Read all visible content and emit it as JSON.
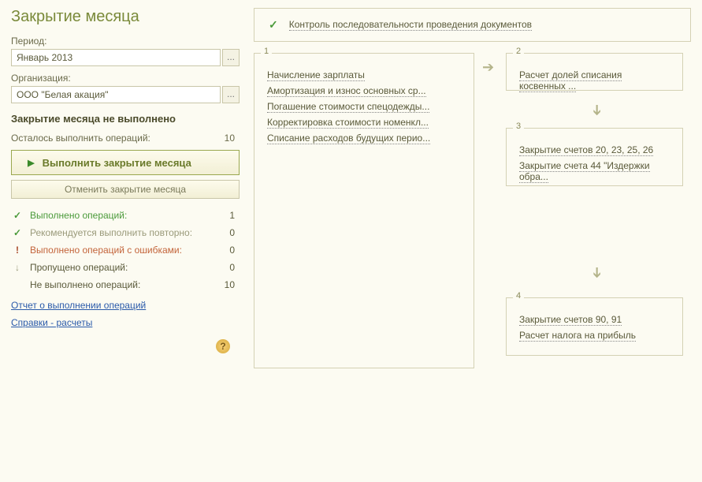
{
  "title": "Закрытие месяца",
  "period_label": "Период:",
  "period_value": "Январь 2013",
  "org_label": "Организация:",
  "org_value": "ООО \"Белая акация\"",
  "status": "Закрытие месяца не выполнено",
  "remaining_label": "Осталось выполнить операций:",
  "remaining_count": "10",
  "execute_button": "Выполнить закрытие месяца",
  "cancel_button": "Отменить закрытие месяца",
  "stats": [
    {
      "icon": "✓",
      "iconClass": "green",
      "label": "Выполнено операций:",
      "labelClass": "green",
      "count": "1"
    },
    {
      "icon": "✓",
      "iconClass": "green",
      "label": "Рекомендуется выполнить повторно:",
      "labelClass": "gray",
      "count": "0"
    },
    {
      "icon": "!",
      "iconClass": "darkred",
      "label": "Выполнено операций с ошибками:",
      "labelClass": "red",
      "count": "0"
    },
    {
      "icon": "↓",
      "iconClass": "gray",
      "label": "Пропущено операций:",
      "labelClass": "",
      "count": "0"
    },
    {
      "icon": "",
      "iconClass": "",
      "label": "Не выполнено операций:",
      "labelClass": "",
      "count": "10"
    }
  ],
  "link_report": "Отчет о выполнении операций",
  "link_refs": "Справки - расчеты",
  "control_link": "Контроль последовательности проведения документов",
  "steps": {
    "s1": [
      "Начисление зарплаты",
      "Амортизация и износ основных ср...",
      "Погашение стоимости спецодежды...",
      "Корректировка стоимости номенкл...",
      "Списание расходов будущих перио..."
    ],
    "s2": [
      "Расчет долей списания косвенных ..."
    ],
    "s3": [
      "Закрытие счетов 20, 23, 25, 26",
      "Закрытие счета 44 \"Издержки обра..."
    ],
    "s4": [
      "Закрытие счетов 90, 91",
      "Расчет налога на прибыль"
    ]
  }
}
